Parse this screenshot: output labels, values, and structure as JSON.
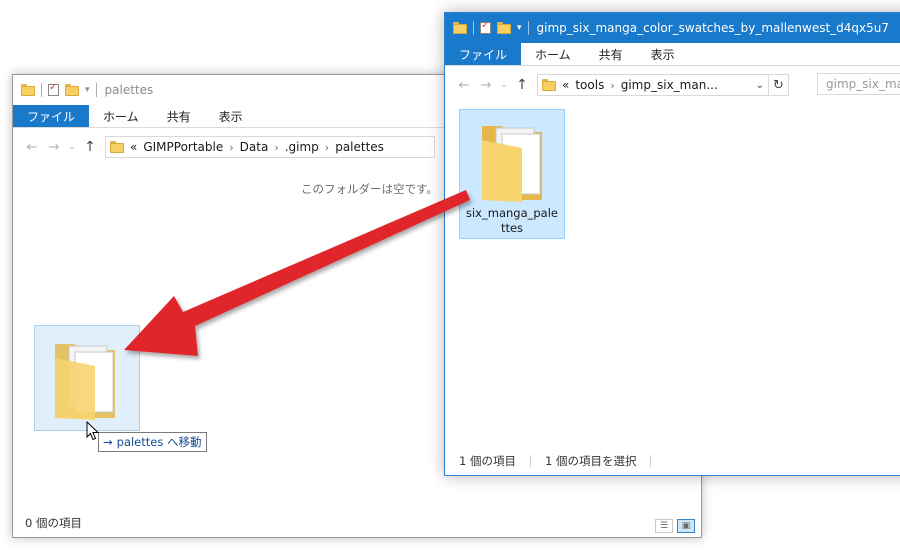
{
  "left_window": {
    "title": "palettes",
    "ribbon_tabs": [
      "ファイル",
      "ホーム",
      "共有",
      "表示"
    ],
    "breadcrumb": [
      "GIMPPortable",
      "Data",
      ".gimp",
      "palettes"
    ],
    "overflow_marker": "«",
    "empty_message": "このフォルダーは空です。",
    "status_count": "0 個の項目"
  },
  "right_window": {
    "title": "gimp_six_manga_color_swatches_by_mallenwest_d4qx5u7",
    "ribbon_tabs": [
      "ファイル",
      "ホーム",
      "共有",
      "表示"
    ],
    "breadcrumb": [
      "tools",
      "gimp_six_man..."
    ],
    "overflow_marker": "«",
    "search_placeholder": "gimp_six_manga",
    "folder_item": "six_manga_palettes",
    "status_count": "1 個の項目",
    "status_selected": "1 個の項目を選択"
  },
  "drag": {
    "tooltip_arrow": "→",
    "tooltip_text": "palettes へ移動"
  },
  "colors": {
    "accent_blue": "#1979ca",
    "selection": "#cce8ff",
    "arrow_red": "#e0262b"
  }
}
